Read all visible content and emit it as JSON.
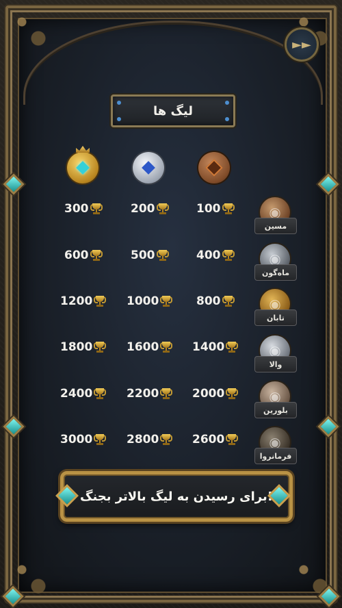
{
  "title": "لیگ ها",
  "back_icon": "double-arrow-icon",
  "header_medals": [
    "gold-medal-icon",
    "silver-medal-icon",
    "bronze-medal-icon"
  ],
  "rows": [
    {
      "league": "مسین",
      "values": [
        "300",
        "200",
        "100"
      ]
    },
    {
      "league": "ماه‌گون",
      "values": [
        "600",
        "500",
        "400"
      ]
    },
    {
      "league": "تابان",
      "values": [
        "1200",
        "1000",
        "800"
      ]
    },
    {
      "league": "والا",
      "values": [
        "1800",
        "1600",
        "1400"
      ]
    },
    {
      "league": "بلورین",
      "values": [
        "2400",
        "2200",
        "2000"
      ]
    },
    {
      "league": "فرمانروا",
      "values": [
        "3000",
        "2800",
        "2600"
      ]
    }
  ],
  "banner_text": "برای رسیدن به لیگ بالاتر بجنگ!",
  "colors": {
    "accent_gold": "#b99245",
    "gem": "#35d0d8"
  }
}
